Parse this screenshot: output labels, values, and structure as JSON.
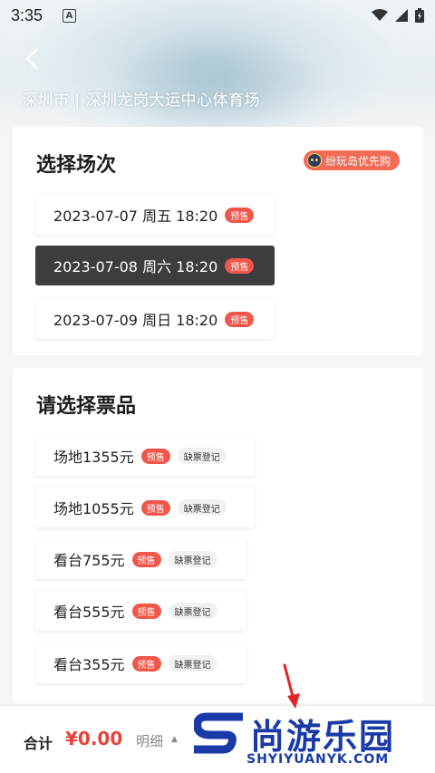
{
  "status_bar": {
    "time": "3:35",
    "notification_icon_letter": "A"
  },
  "header": {
    "venue": "深圳市 | 深圳龙岗大运中心体育场"
  },
  "sessions_section": {
    "title": "选择场次",
    "promo_badge": "纷玩岛优先购",
    "sessions": [
      {
        "label": "2023-07-07 周五 18:20",
        "tag": "预售",
        "selected": false
      },
      {
        "label": "2023-07-08 周六 18:20",
        "tag": "预售",
        "selected": true
      },
      {
        "label": "2023-07-09 周日 18:20",
        "tag": "预售",
        "selected": false
      }
    ]
  },
  "tickets_section": {
    "title": "请选择票品",
    "tickets": [
      {
        "label": "场地1355元",
        "presale": "预售",
        "waitlist": "缺票登记"
      },
      {
        "label": "场地1055元",
        "presale": "预售",
        "waitlist": "缺票登记"
      },
      {
        "label": "看台755元",
        "presale": "预售",
        "waitlist": "缺票登记"
      },
      {
        "label": "看台555元",
        "presale": "预售",
        "waitlist": "缺票登记"
      },
      {
        "label": "看台355元",
        "presale": "预售",
        "waitlist": "缺票登记"
      }
    ]
  },
  "footer": {
    "total_label": "合计",
    "total_amount": "¥0.00",
    "detail_label": "明细",
    "detail_arrow": "▲"
  },
  "watermark": {
    "text": "尚游乐园",
    "domain": "SHYIYUANYK.COM"
  },
  "colors": {
    "accent_red": "#f0574a",
    "selected_dark": "#3d3d3f",
    "watermark_blue": "#1a3aa8"
  }
}
